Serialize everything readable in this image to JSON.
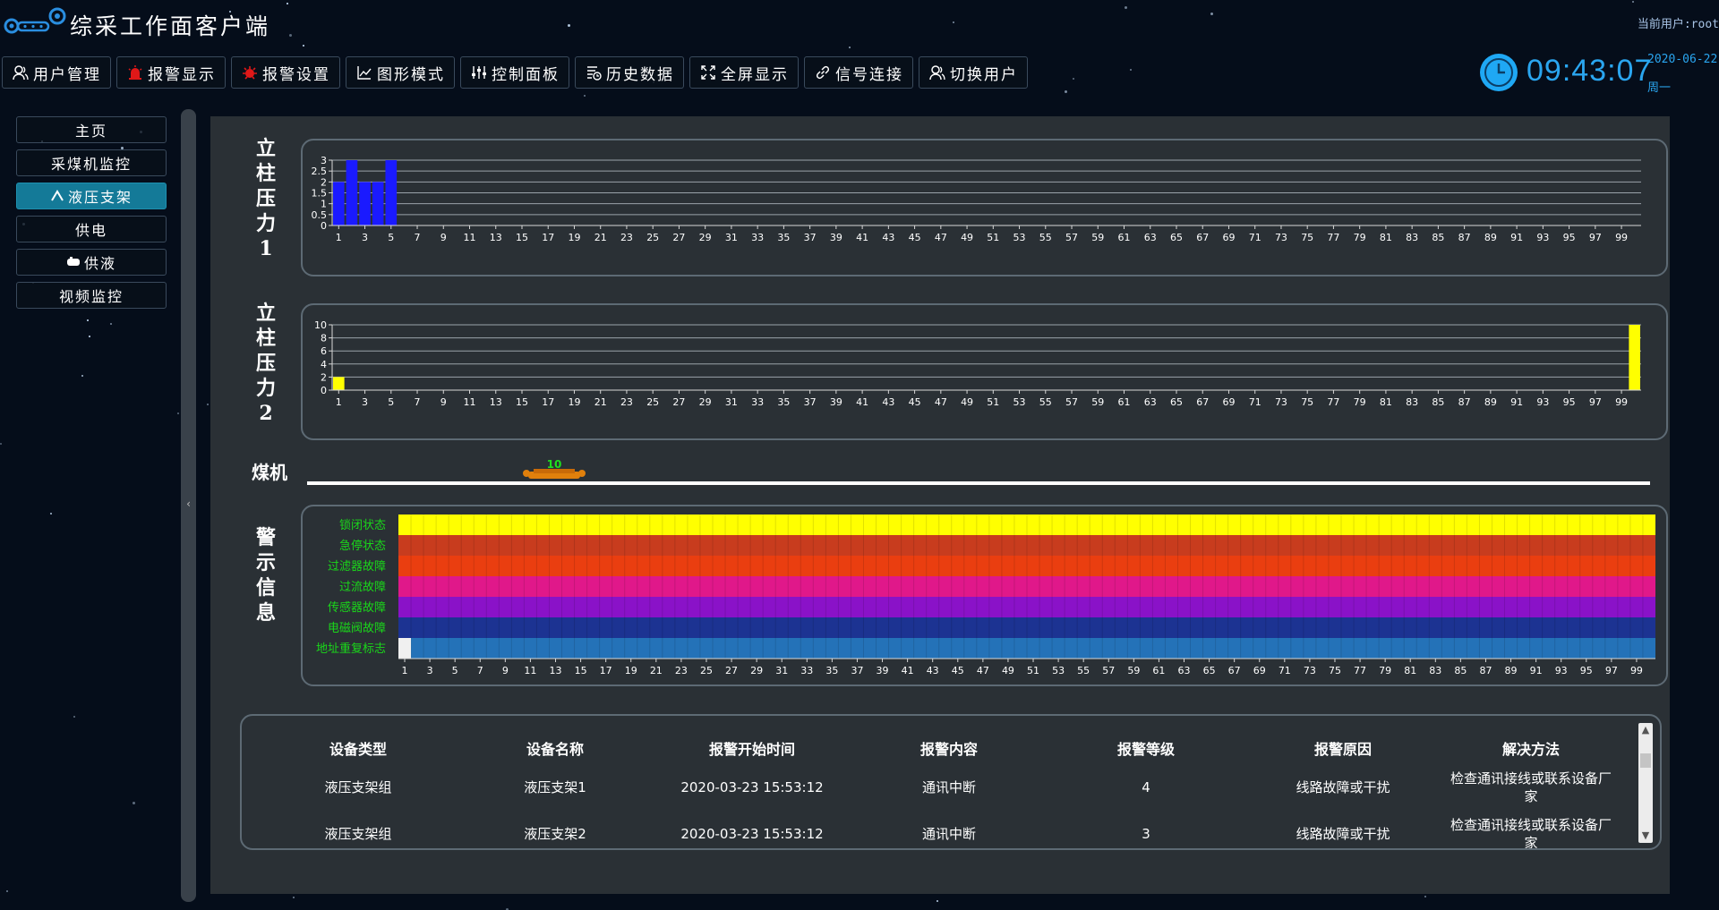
{
  "header": {
    "title": "综采工作面客户端",
    "current_user": "当前用户:root",
    "logo_icon": "gear-chain-logo-icon"
  },
  "toolbar": [
    {
      "label": "用户管理",
      "icon": "user-icon"
    },
    {
      "label": "报警显示",
      "icon": "alarm-light-icon"
    },
    {
      "label": "报警设置",
      "icon": "alarm-settings-icon"
    },
    {
      "label": "图形模式",
      "icon": "line-chart-icon"
    },
    {
      "label": "控制面板",
      "icon": "sliders-icon"
    },
    {
      "label": "历史数据",
      "icon": "history-icon"
    },
    {
      "label": "全屏显示",
      "icon": "fullscreen-icon"
    },
    {
      "label": "信号连接",
      "icon": "link-icon"
    },
    {
      "label": "切换用户",
      "icon": "switch-user-icon"
    }
  ],
  "clock": {
    "time": "09:43:07",
    "date": "2020-06-22",
    "weekday": "周一",
    "icon": "clock-icon"
  },
  "sidebar": {
    "items": [
      {
        "label": "主页",
        "active": false
      },
      {
        "label": "采煤机监控",
        "active": false
      },
      {
        "label": "液压支架",
        "active": true,
        "icon": "support-icon"
      },
      {
        "label": "供电",
        "active": false
      },
      {
        "label": "供液",
        "active": false,
        "icon": "tank-icon"
      },
      {
        "label": "视频监控",
        "active": false
      }
    ]
  },
  "labels": {
    "pressure1": "立柱压力1",
    "pressure2": "立柱压力2",
    "shearer": "煤机",
    "warnings": "警示信息"
  },
  "shearer": {
    "position": 10,
    "position_label": "10",
    "max_position": 100
  },
  "colors": {
    "bar1": "#1a1aff",
    "bar2": "#ffff00",
    "axis": "#d8d8d8",
    "warning_label": "#1ad81a",
    "accent": "#2aa6f0"
  },
  "chart_data": [
    {
      "type": "bar",
      "title": "立柱压力1",
      "x_start": 1,
      "x_end": 100,
      "x_tick_step": 2,
      "ylim": [
        0,
        3
      ],
      "yticks": [
        "0",
        "0.5",
        "1",
        "1.5",
        "2",
        "2.5",
        "3"
      ],
      "nonzero_values": {
        "1": 2,
        "2": 3,
        "3": 2,
        "4": 2,
        "5": 3
      },
      "grid": true,
      "color": "#1a1aff"
    },
    {
      "type": "bar",
      "title": "立柱压力2",
      "x_start": 1,
      "x_end": 100,
      "x_tick_step": 2,
      "ylim": [
        0,
        10
      ],
      "yticks": [
        "0",
        "2",
        "4",
        "6",
        "8",
        "10"
      ],
      "nonzero_values": {
        "1": 2,
        "100": 10
      },
      "grid": true,
      "color": "#ffff00"
    },
    {
      "type": "heatmap",
      "title": "警示信息",
      "x_start": 1,
      "x_end": 100,
      "x_tick_step": 2,
      "rows": [
        {
          "name": "锁闭状态",
          "color": "#ffff00"
        },
        {
          "name": "急停状态",
          "color": "#c83c1e"
        },
        {
          "name": "过滤器故障",
          "color": "#ea3e10"
        },
        {
          "name": "过流故障",
          "color": "#e0188a"
        },
        {
          "name": "传感器故障",
          "color": "#8a12c8"
        },
        {
          "name": "电磁阀故障",
          "color": "#1c3392"
        },
        {
          "name": "地址重复标志",
          "color": "#2472b8"
        }
      ],
      "exceptions": [
        {
          "row": 6,
          "x": 1,
          "color": "#f0f0f0"
        }
      ]
    }
  ],
  "alarm_table": {
    "columns": [
      "设备类型",
      "设备名称",
      "报警开始时间",
      "报警内容",
      "报警等级",
      "报警原因",
      "解决方法"
    ],
    "rows": [
      [
        "液压支架组",
        "液压支架1",
        "2020-03-23 15:53:12",
        "通讯中断",
        "4",
        "线路故障或干扰",
        "检查通讯接线或联系设备厂家"
      ],
      [
        "液压支架组",
        "液压支架2",
        "2020-03-23 15:53:12",
        "通讯中断",
        "3",
        "线路故障或干扰",
        "检查通讯接线或联系设备厂家"
      ]
    ]
  }
}
